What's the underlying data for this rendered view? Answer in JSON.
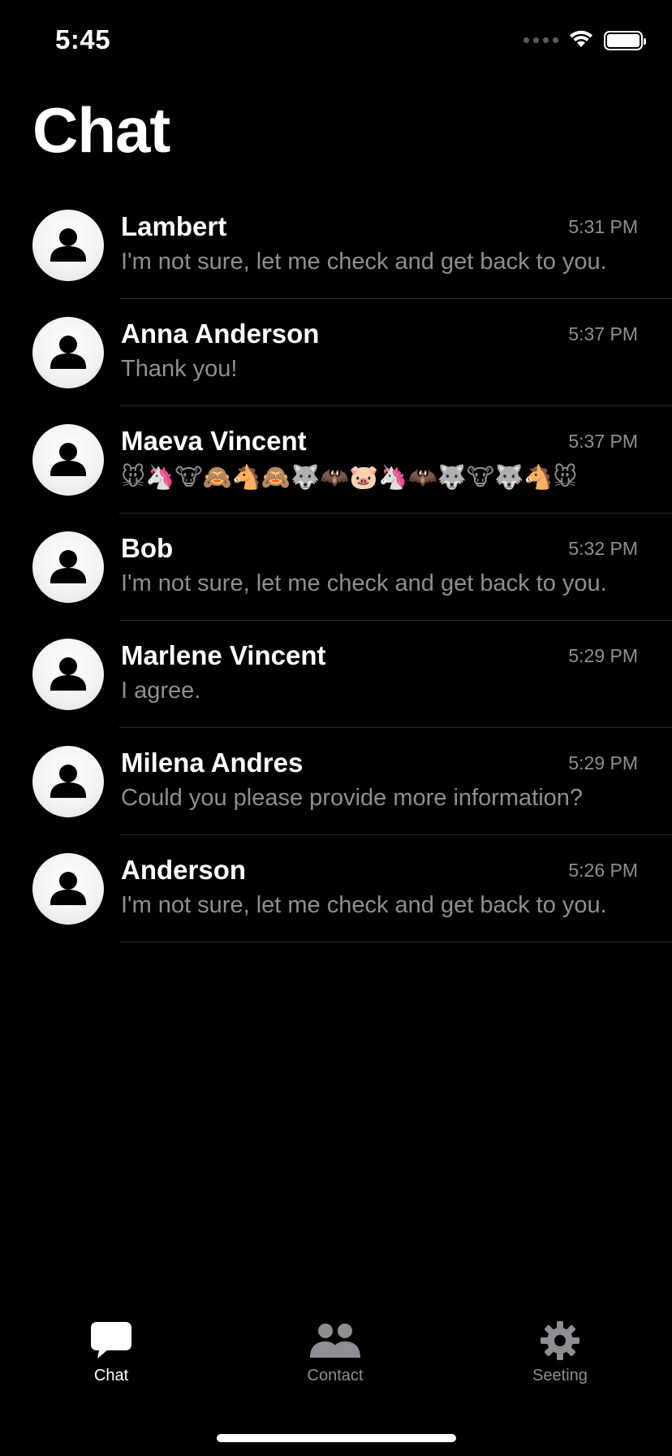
{
  "status_bar": {
    "time": "5:45"
  },
  "page": {
    "title": "Chat"
  },
  "chats": [
    {
      "name": "Lambert",
      "time": "5:31 PM",
      "preview": "I'm not sure, let me check and get back to you."
    },
    {
      "name": "Anna Anderson",
      "time": "5:37 PM",
      "preview": "Thank you!"
    },
    {
      "name": "Maeva Vincent",
      "time": "5:37 PM",
      "preview": "🐭🦄🐮🙈🐴🙈🐺🦇🐷🦄🦇🐺🐮🐺🐴🐭"
    },
    {
      "name": "Bob",
      "time": "5:32 PM",
      "preview": "I'm not sure, let me check and get back to you."
    },
    {
      "name": "Marlene Vincent",
      "time": "5:29 PM",
      "preview": "I agree."
    },
    {
      "name": "Milena Andres",
      "time": "5:29 PM",
      "preview": "Could you please provide more information?"
    },
    {
      "name": "Anderson",
      "time": "5:26 PM",
      "preview": "I'm not sure, let me check and get back to you."
    }
  ],
  "tab_bar": {
    "tabs": [
      {
        "label": "Chat",
        "icon": "chat-bubble-icon",
        "active": true
      },
      {
        "label": "Contact",
        "icon": "people-icon",
        "active": false
      },
      {
        "label": "Seeting",
        "icon": "gear-icon",
        "active": false
      }
    ]
  },
  "colors": {
    "background": "#000000",
    "primary_text": "#ffffff",
    "secondary_text": "#8e8e93",
    "divider": "#2c2c2e"
  }
}
